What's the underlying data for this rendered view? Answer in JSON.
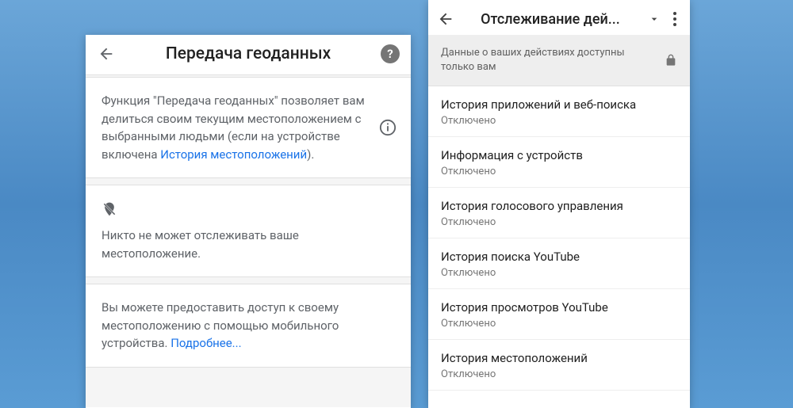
{
  "left": {
    "title": "Передача геоданных",
    "desc_pre": "Функция \"Передача геоданных\" позволяет вам делиться своим текущим местоположением с выбранными людьми (если на устройстве включена ",
    "desc_link": "История местоположений",
    "desc_post": ").",
    "nobody_text": "Никто не может отслеживать ваше местоположение.",
    "access_pre": "Вы можете предоставить доступ к своему местоположению с помощью мобильного устройства. ",
    "access_link": "Подробнее..."
  },
  "right": {
    "title": "Отслеживание дей...",
    "privacy": "Данные о ваших действиях доступны только вам",
    "items": [
      {
        "title": "История приложений и веб-поиска",
        "status": "Отключено"
      },
      {
        "title": "Информация с устройств",
        "status": "Отключено"
      },
      {
        "title": "История голосового управления",
        "status": "Отключено"
      },
      {
        "title": "История поиска YouTube",
        "status": "Отключено"
      },
      {
        "title": "История просмотров YouTube",
        "status": "Отключено"
      },
      {
        "title": "История местоположений",
        "status": "Отключено"
      }
    ]
  }
}
